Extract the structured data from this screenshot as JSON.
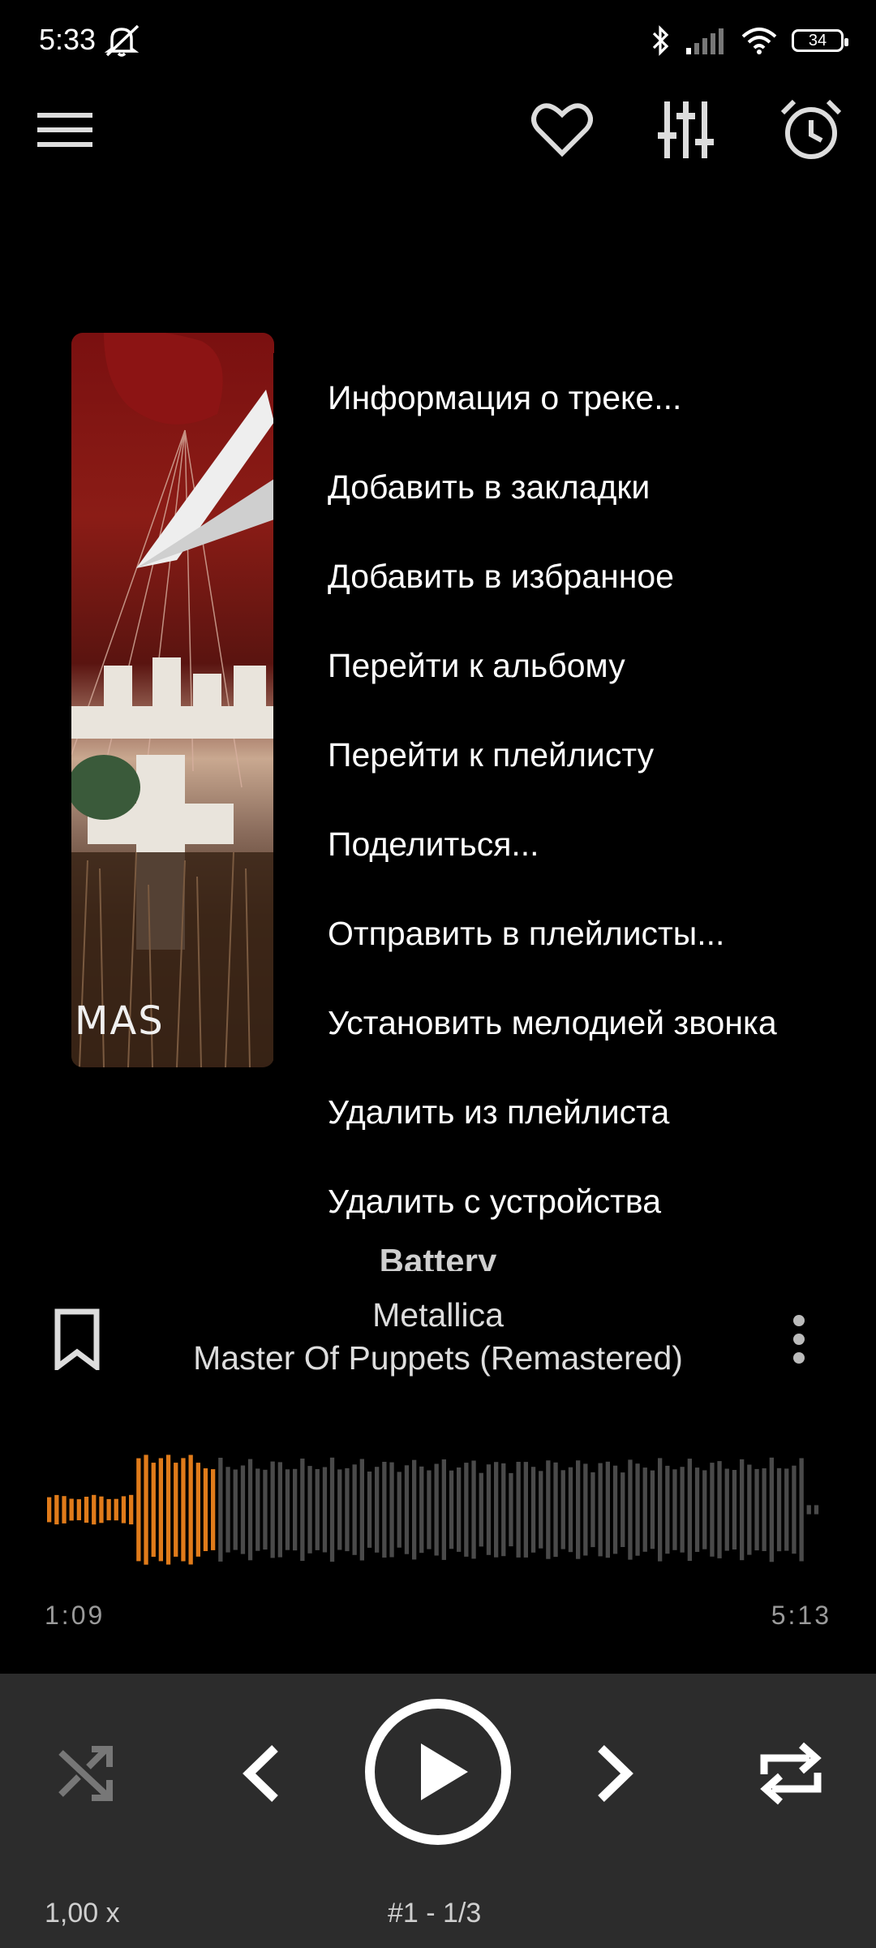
{
  "status_bar": {
    "time": "5:33",
    "battery": "34",
    "icons": [
      "mute-bell-icon",
      "bluetooth-icon",
      "signal-icon",
      "wifi-icon",
      "battery-icon"
    ]
  },
  "toolbar": {
    "icons": [
      "menu-icon",
      "heart-icon",
      "equalizer-icon",
      "alarm-icon"
    ]
  },
  "album": {
    "cover_text": "MAS"
  },
  "context_menu": {
    "items": [
      "Информация о треке...",
      "Добавить в закладки",
      "Добавить в избранное",
      "Перейти к альбому",
      "Перейти к плейлисту",
      "Поделиться...",
      "Отправить в плейлисты...",
      "Установить мелодией звонка",
      "Удалить из плейлиста",
      "Удалить с устройства"
    ]
  },
  "track": {
    "title": "Battery",
    "artist": "Metallica",
    "album": "Master Of Puppets (Remastered)"
  },
  "playback": {
    "elapsed": "1:09",
    "duration": "5:13",
    "progress_fraction": 0.22,
    "accent_color": "#e07b1a",
    "inactive_color": "#4a4a4a"
  },
  "controls": {
    "speed": "1,00 x",
    "queue_position": "#1 - 1/3",
    "icons": [
      "shuffle-icon",
      "previous-icon",
      "play-icon",
      "next-icon",
      "repeat-icon"
    ]
  }
}
